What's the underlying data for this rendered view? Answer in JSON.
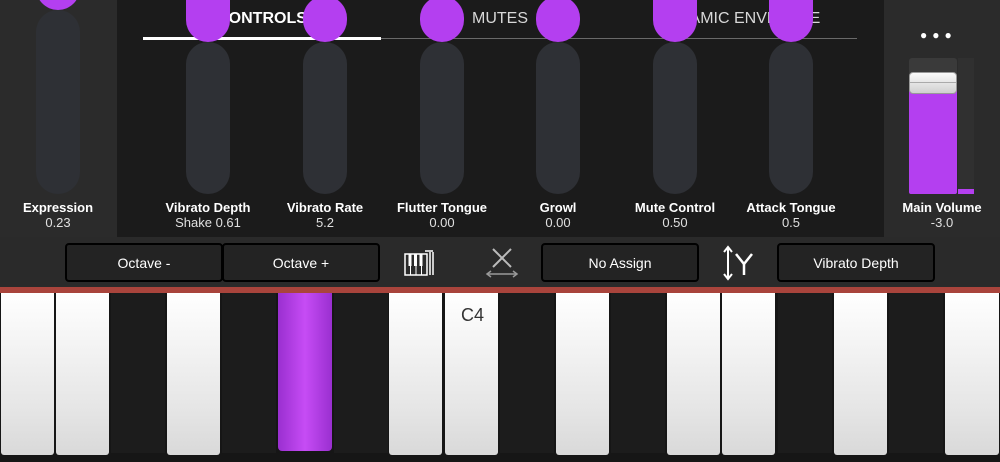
{
  "tabs": [
    {
      "label": "CONTROLS",
      "active": true
    },
    {
      "label": "MUTES",
      "active": false
    },
    {
      "label": "DYNAMIC ENVELOPE",
      "active": false
    }
  ],
  "expression": {
    "label": "Expression",
    "value": "0.23",
    "level": 0.0
  },
  "controls": [
    {
      "label": "Vibrato Depth",
      "value": "Shake 0.61",
      "level": 0.61
    },
    {
      "label": "Vibrato Rate",
      "value": "5.2",
      "level": 0.0
    },
    {
      "label": "Flutter Tongue",
      "value": "0.00",
      "level": 0.0
    },
    {
      "label": "Growl",
      "value": "0.00",
      "level": 0.0
    },
    {
      "label": "Mute Control",
      "value": "0.50",
      "level": 0.5
    },
    {
      "label": "Attack Tongue",
      "value": "0.5",
      "level": 0.5
    }
  ],
  "main_volume": {
    "label": "Main Volume",
    "value": "-3.0"
  },
  "menu": {
    "icon": "more-dots-icon",
    "glyph": "●●●"
  },
  "toolbar": {
    "octave_down": "Octave -",
    "octave_up": "Octave +",
    "no_assign": "No Assign",
    "vibrato_depth": "Vibrato Depth"
  },
  "keyboard": {
    "c4_label": "C4",
    "pressed_key": "black-key-3"
  },
  "colors": {
    "accent": "#b43ff0",
    "divider": "#a9443c"
  }
}
